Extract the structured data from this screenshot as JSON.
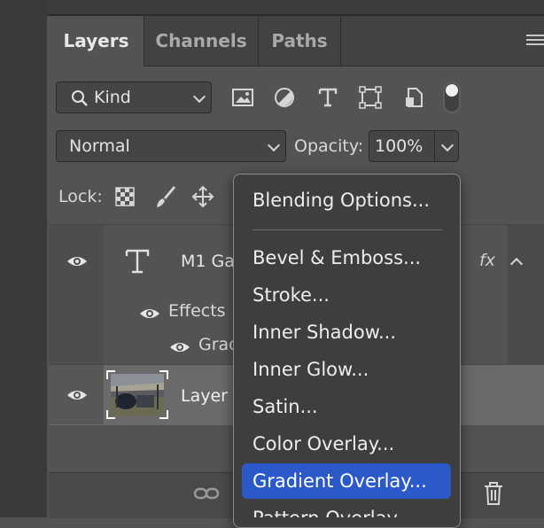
{
  "tabs": [
    {
      "label": "Layers",
      "active": true
    },
    {
      "label": "Channels",
      "active": false
    },
    {
      "label": "Paths",
      "active": false
    }
  ],
  "filter": {
    "kind_label": "Kind"
  },
  "blend": {
    "mode": "Normal",
    "opacity_label": "Opacity:",
    "opacity_value": "100%"
  },
  "lock": {
    "label": "Lock:"
  },
  "layers": [
    {
      "name": "M1 Ga",
      "type": "text",
      "fx": "fx",
      "effects_label": "Effects",
      "effect_item": "Grad"
    },
    {
      "name": "Layer",
      "type": "image"
    }
  ],
  "context_menu": {
    "items": [
      "Blending Options...",
      "Bevel & Emboss...",
      "Stroke...",
      "Inner Shadow...",
      "Inner Glow...",
      "Satin...",
      "Color Overlay...",
      "Gradient Overlay...",
      "Pattern Overlay..."
    ],
    "selected": "Gradient Overlay...",
    "highlight_color": "#2b5ac8"
  },
  "icons": [
    "search-icon",
    "image-filter-icon",
    "adjustment-filter-icon",
    "type-filter-icon",
    "shape-filter-icon",
    "smart-object-filter-icon",
    "filter-toggle",
    "lock-pixels-icon",
    "lock-brush-icon",
    "lock-move-icon",
    "eye-icon",
    "type-layer-icon",
    "link-icon",
    "trash-icon",
    "panel-menu-icon"
  ]
}
